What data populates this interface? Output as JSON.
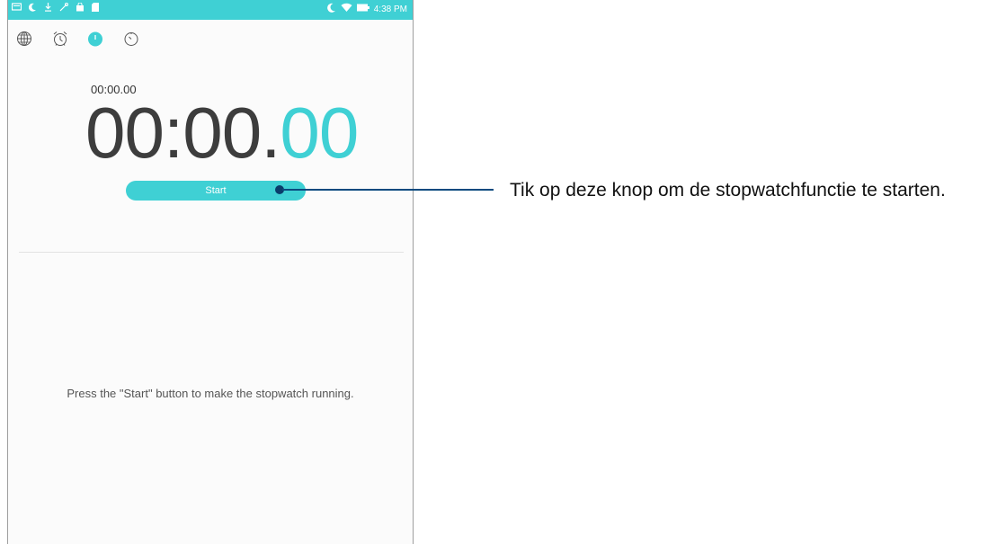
{
  "statusbar": {
    "time": "4:38 PM",
    "left_icons": [
      "message-icon",
      "moon-icon",
      "download-icon",
      "tool-icon",
      "shopping-bag-icon",
      "sd-card-icon"
    ],
    "right_icons": [
      "moon-icon",
      "wifi-icon",
      "battery-icon"
    ]
  },
  "tabs": [
    {
      "name": "world-clock",
      "icon": "globe-icon"
    },
    {
      "name": "alarm",
      "icon": "alarm-clock-icon"
    },
    {
      "name": "stopwatch",
      "icon": "stopwatch-icon",
      "active": true
    },
    {
      "name": "timer",
      "icon": "timer-icon"
    }
  ],
  "stopwatch": {
    "lap_time": "00:00.00",
    "main_time": "00:00.",
    "centiseconds": "00",
    "start_label": "Start",
    "hint": "Press the \"Start\" button to make the stopwatch running."
  },
  "callout": {
    "text": "Tik op deze knop om de stopwatchfunctie te starten."
  },
  "colors": {
    "accent": "#3fd0d4",
    "callout": "#0a4a7f"
  }
}
